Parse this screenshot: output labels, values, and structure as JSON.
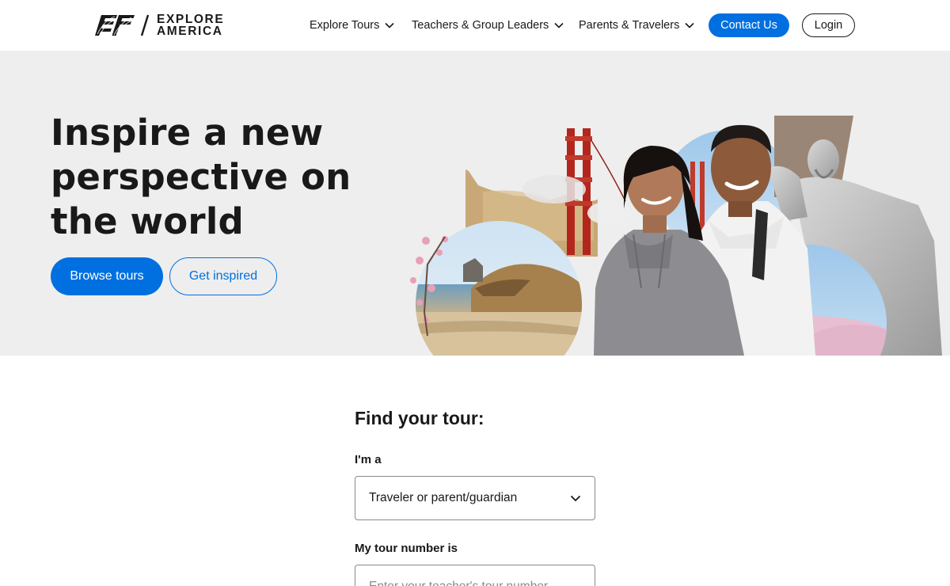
{
  "brand": {
    "logo_mark": "EF",
    "line1": "EXPLORE",
    "line2": "AMERICA",
    "accent": "#0070e0"
  },
  "nav": {
    "tours_label": "Explore Tours",
    "teachers_label": "Teachers & Group Leaders",
    "parents_label": "Parents & Travelers",
    "contact_label": "Contact Us",
    "login_label": "Login"
  },
  "hero": {
    "title": "Inspire a new perspective on the world",
    "browse_label": "Browse tours",
    "inspired_label": "Get inspired",
    "background": "#eeeeee"
  },
  "finder": {
    "title": "Find your tour:",
    "role_label": "I'm a",
    "role_value": "Traveler or parent/guardian",
    "tour_label": "My tour number is",
    "tour_placeholder": "Enter your teacher's tour number"
  },
  "icons": {
    "dropdown": "chevron-down-icon"
  }
}
